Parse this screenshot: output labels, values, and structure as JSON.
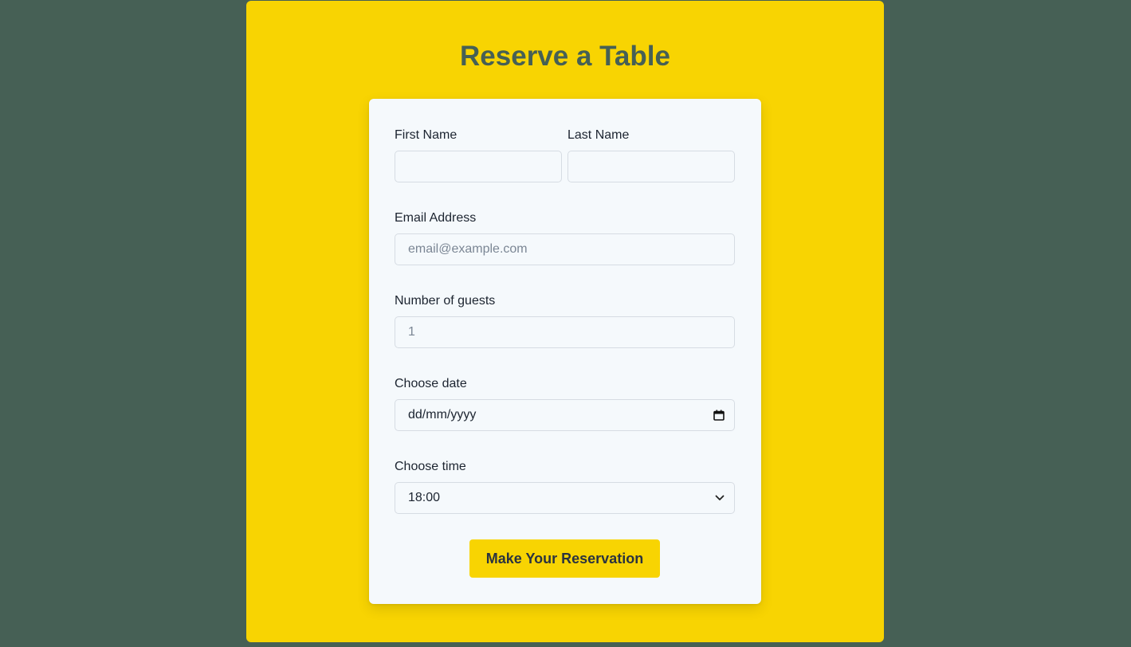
{
  "page": {
    "title": "Reserve a Table"
  },
  "form": {
    "first_name": {
      "label": "First Name",
      "value": "",
      "placeholder": ""
    },
    "last_name": {
      "label": "Last Name",
      "value": "",
      "placeholder": ""
    },
    "email": {
      "label": "Email Address",
      "value": "",
      "placeholder": "email@example.com"
    },
    "guests": {
      "label": "Number of guests",
      "value": "",
      "placeholder": "1"
    },
    "date": {
      "label": "Choose date",
      "value": "dd/mm/yyyy",
      "icon": "calendar-icon"
    },
    "time": {
      "label": "Choose time",
      "selected": "18:00",
      "icon": "chevron-down-icon"
    },
    "submit_label": "Make Your Reservation"
  },
  "colors": {
    "background": "#466055",
    "panel": "#f8d402",
    "card": "#f5f9fc",
    "title": "#466055",
    "button": "#f8d402"
  }
}
